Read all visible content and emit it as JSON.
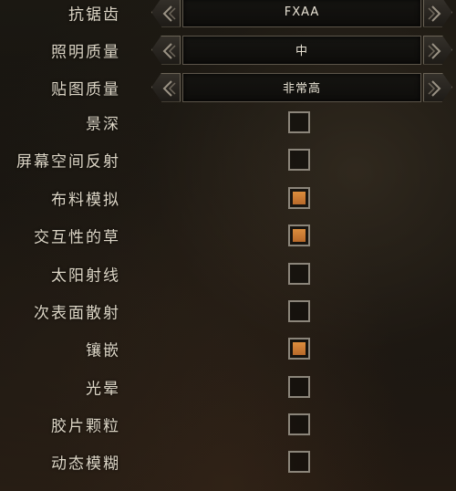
{
  "settings": {
    "selectors": [
      {
        "label": "抗锯齿",
        "value": "FXAA"
      },
      {
        "label": "照明质量",
        "value": "中"
      },
      {
        "label": "贴图质量",
        "value": "非常高"
      }
    ],
    "toggles": [
      {
        "label": "景深",
        "checked": false
      },
      {
        "label": "屏幕空间反射",
        "checked": false
      },
      {
        "label": "布料模拟",
        "checked": true
      },
      {
        "label": "交互性的草",
        "checked": true
      },
      {
        "label": "太阳射线",
        "checked": false
      },
      {
        "label": "次表面散射",
        "checked": false
      },
      {
        "label": "镶嵌",
        "checked": true
      },
      {
        "label": "光晕",
        "checked": false
      },
      {
        "label": "胶片颗粒",
        "checked": false
      },
      {
        "label": "动态模糊",
        "checked": false
      }
    ]
  },
  "colors": {
    "accent": "#d0813a",
    "checkbox_border": "#8b857a"
  }
}
